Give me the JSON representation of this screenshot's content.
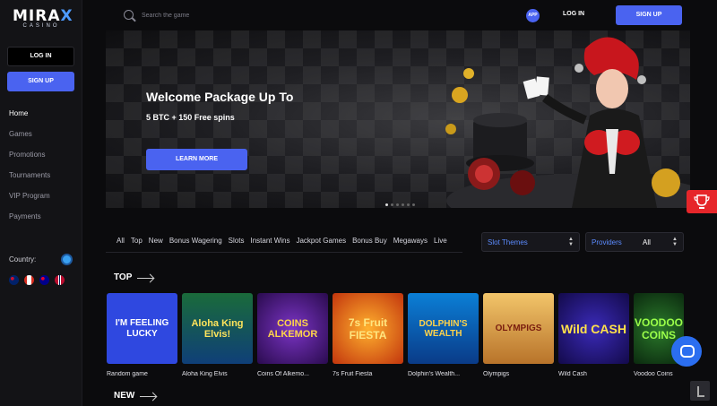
{
  "brand": {
    "name_left": "MIRA",
    "name_right": "X",
    "sub": "CASINO"
  },
  "sidebar": {
    "login": "LOG IN",
    "signup": "SIGN UP",
    "nav": [
      "Home",
      "Games",
      "Promotions",
      "Tournaments",
      "VIP Program",
      "Payments"
    ],
    "country_label": "Country:"
  },
  "topbar": {
    "search_placeholder": "Search the game",
    "app": "APP",
    "login": "LOG IN",
    "signup": "SIGN UP"
  },
  "banner": {
    "title": "Welcome Package Up To",
    "subtitle": "5 BTC + 150 Free spins",
    "cta": "LEARN MORE"
  },
  "filters": [
    "All",
    "Top",
    "New",
    "Bonus Wagering",
    "Slots",
    "Instant Wins",
    "Jackpot Games",
    "Bonus Buy",
    "Megaways",
    "Live"
  ],
  "selects": {
    "themes_label": "Slot Themes",
    "providers_label": "Providers",
    "providers_value": "All"
  },
  "sections": {
    "top": "TOP",
    "new": "NEW"
  },
  "games": [
    {
      "name": "Random game",
      "art": "I'M FEELING LUCKY"
    },
    {
      "name": "Aloha King Elvis",
      "art": "Aloha King Elvis!"
    },
    {
      "name": "Coins Of Alkemo...",
      "art": "COINS ALKEMOR"
    },
    {
      "name": "7s Fruit Fiesta",
      "art": "7s Fruit FIESTA"
    },
    {
      "name": "Dolphin's Wealth...",
      "art": "DOLPHIN'S WEALTH"
    },
    {
      "name": "Olympigs",
      "art": "OLYMPIGS"
    },
    {
      "name": "Wild Cash",
      "art": "Wild CASH"
    },
    {
      "name": "Voodoo Coins",
      "art": "VOODOO COINS"
    }
  ],
  "colors": {
    "accent": "#4a63f0",
    "trophy": "#e6262a",
    "chat": "#2b6ef0"
  }
}
